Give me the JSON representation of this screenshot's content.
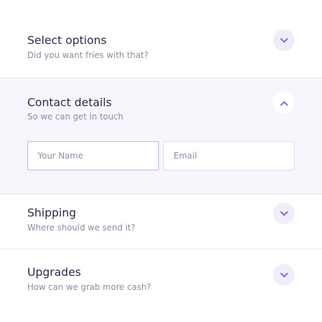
{
  "sections": [
    {
      "title": "Select options",
      "subtitle": "Did you want fries with that?",
      "icon": "chevron-down-icon",
      "expanded": false
    },
    {
      "title": "Contact details",
      "subtitle": "So we can get in touch",
      "icon": "chevron-up-icon",
      "expanded": true,
      "fields": {
        "name_placeholder": "Your Name",
        "name_value": "",
        "email_placeholder": "Email",
        "email_value": ""
      }
    },
    {
      "title": "Shipping",
      "subtitle": "Where should we send it?",
      "icon": "chevron-down-icon",
      "expanded": false
    },
    {
      "title": "Upgrades",
      "subtitle": "How can we grab more cash?",
      "icon": "chevron-down-icon",
      "expanded": false
    }
  ],
  "colors": {
    "accent": "#7b6ee6",
    "toggle_bg": "#eeeefb",
    "open_section_bg": "#f6f6fd",
    "title": "#2b2b46",
    "subtitle": "#8c8ca2"
  }
}
